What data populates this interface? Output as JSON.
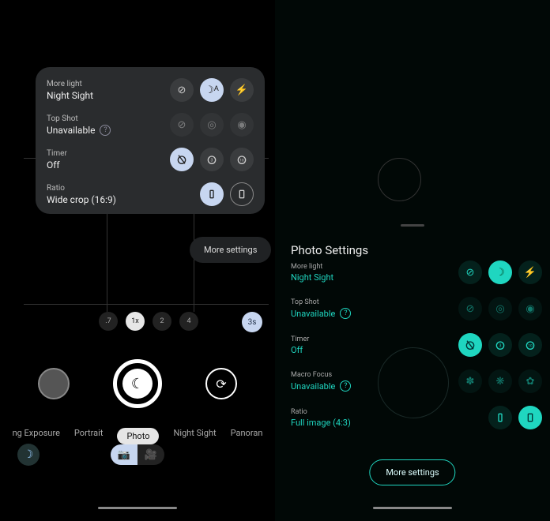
{
  "left": {
    "rows": {
      "morelight": {
        "label": "More light",
        "value": "Night Sight"
      },
      "topshot": {
        "label": "Top Shot",
        "value": "Unavailable"
      },
      "timer": {
        "label": "Timer",
        "value": "Off"
      },
      "ratio": {
        "label": "Ratio",
        "value": "Wide crop (16:9)"
      }
    },
    "more_settings": "More settings",
    "zoom": {
      "v1": ".7",
      "v2": "1x",
      "v3": "2",
      "v4": "4"
    },
    "timer_badge": "3s",
    "modes": {
      "m1": "ng Exposure",
      "m2": "Portrait",
      "m3": "Photo",
      "m4": "Night Sight",
      "m5": "Panoran"
    }
  },
  "right": {
    "title": "Photo Settings",
    "rows": {
      "morelight": {
        "label": "More light",
        "value": "Night Sight"
      },
      "topshot": {
        "label": "Top Shot",
        "value": "Unavailable"
      },
      "timer": {
        "label": "Timer",
        "value": "Off"
      },
      "macro": {
        "label": "Macro Focus",
        "value": "Unavailable"
      },
      "ratio": {
        "label": "Ratio",
        "value": "Full image (4:3)"
      }
    },
    "more_settings": "More settings"
  }
}
